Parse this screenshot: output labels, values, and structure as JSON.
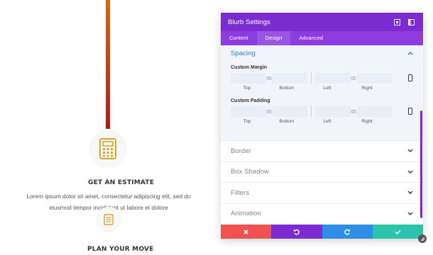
{
  "page": {
    "steps": [
      {
        "title": "GET AN ESTIMATE",
        "text": "Lorem ipsum dolor sit amet, consectetur adipiscing elit, sed do eiusmod tempor incididunt ut labore et dolore",
        "icon": "calculator-icon"
      },
      {
        "title": "PLAN YOUR MOVE",
        "icon": "document-icon"
      }
    ],
    "colors": {
      "timeline_top": "#cf6a12",
      "timeline_bottom": "#b01c1c",
      "icon_gold": "#d8a52a"
    }
  },
  "panel": {
    "title": "Blurb Settings",
    "tabs": [
      "Content",
      "Design",
      "Advanced"
    ],
    "active_tab": "Design",
    "spacing": {
      "title": "Spacing",
      "custom_margin": {
        "label": "Custom Margin",
        "sides": [
          "Top",
          "Bottom",
          "Left",
          "Right"
        ]
      },
      "custom_padding": {
        "label": "Custom Padding",
        "sides": [
          "Top",
          "Bottom",
          "Left",
          "Right"
        ]
      }
    },
    "collapsed_sections": [
      "Border",
      "Box Shadow",
      "Filters",
      "Animation"
    ],
    "footer_buttons": [
      {
        "name": "discard",
        "color": "#ef5350"
      },
      {
        "name": "undo",
        "color": "#7b2bd0"
      },
      {
        "name": "redo",
        "color": "#2e8ee6"
      },
      {
        "name": "save",
        "color": "#29c4a9"
      }
    ],
    "colors": {
      "header": "#7b2bd0",
      "tabs": "#8e3ce0",
      "accent_blue": "#2e7bd6"
    }
  }
}
